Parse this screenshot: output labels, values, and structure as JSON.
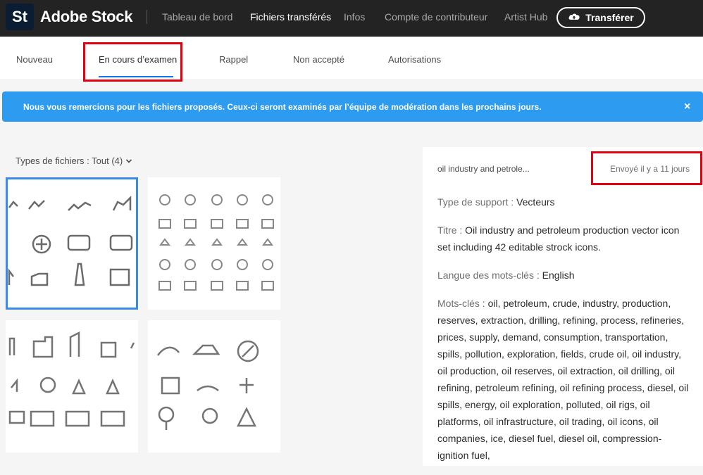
{
  "topbar": {
    "logo_text": "St",
    "brand": "Adobe Stock",
    "nav": [
      "Tableau de bord",
      "Fichiers transférés",
      "Infos",
      "Compte de contributeur",
      "Artist Hub"
    ],
    "active_nav": "Fichiers transférés",
    "upload_label": "Transférer",
    "upload_icon": "cloud-upload-icon"
  },
  "tabs": {
    "items": [
      "Nouveau",
      "En cours d’examen",
      "Rappel",
      "Non accepté",
      "Autorisations"
    ],
    "active": "En cours d’examen"
  },
  "banner": {
    "text": "Nous vous remercions pour les fichiers proposés. Ceux-ci seront examinés par l’équipe de modération dans les prochains jours.",
    "close_symbol": "×"
  },
  "filter": {
    "label": "Types de fichiers : Tout (4)"
  },
  "thumbnails": {
    "count": 4,
    "selected_index": 0
  },
  "details": {
    "file_name": "oil industry and petrole...",
    "sent": "Envoyé il y a 11 jours",
    "media_type_label": "Type de support : ",
    "media_type": "Vecteurs",
    "title_label": "Titre : ",
    "title": "Oil industry and petroleum production vector icon set including 42 editable strock icons.",
    "language_label": "Langue des mots-clés : ",
    "language": "English",
    "keywords_label": "Mots-clés : ",
    "keywords": "oil, petroleum, crude, industry, production, reserves, extraction, drilling, refining, process, refineries, prices, supply, demand, consumption, transportation, spills, pollution, exploration, fields, crude oil, oil industry, oil production, oil reserves, oil extraction, oil drilling, oil refining, petroleum refining, oil refining process, diesel, oil spills, energy, oil exploration, polluted, oil rigs, oil platforms, oil infrastructure, oil trading, oil icons, oil companies, ice, diesel fuel, diesel oil, compression-ignition fuel,"
  },
  "colors": {
    "topbar_bg": "#232323",
    "accent_blue": "#1473e6",
    "banner_bg": "#2d9bf0",
    "highlight_red": "#e3000f",
    "selected_border": "#3b8be3"
  }
}
